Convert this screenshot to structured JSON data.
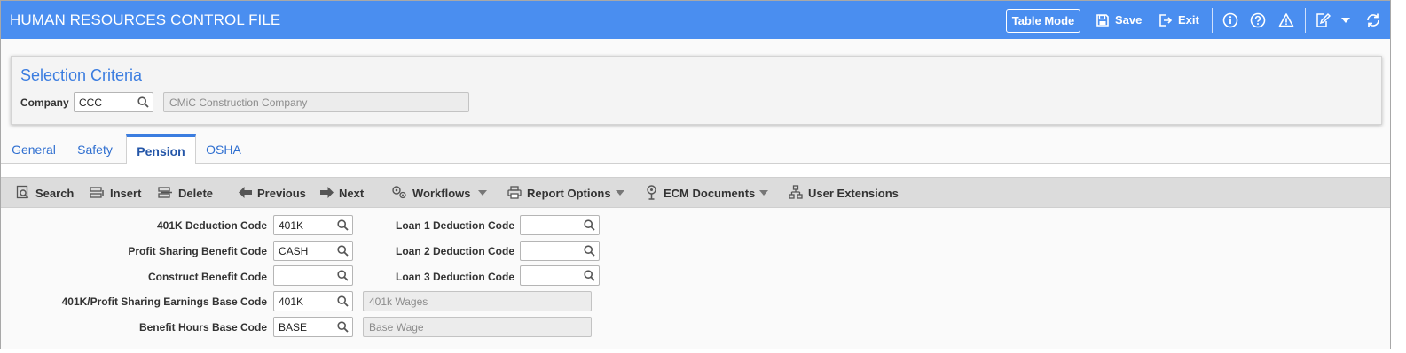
{
  "header": {
    "title": "HUMAN RESOURCES CONTROL FILE",
    "table_mode_label": "Table Mode",
    "save_label": "Save",
    "exit_label": "Exit",
    "icons": [
      "info-icon",
      "help-icon",
      "warning-icon",
      "edit-icon",
      "chevron-down-icon",
      "refresh-icon"
    ]
  },
  "criteria": {
    "title": "Selection Criteria",
    "company_label": "Company",
    "company_value": "CCC",
    "company_name": "CMiC Construction Company"
  },
  "tabs": [
    {
      "label": "General",
      "active": false
    },
    {
      "label": "Safety",
      "active": false
    },
    {
      "label": "Pension",
      "active": true
    },
    {
      "label": "OSHA",
      "active": false
    }
  ],
  "actions": {
    "search": "Search",
    "insert": "Insert",
    "delete": "Delete",
    "previous": "Previous",
    "next": "Next",
    "workflows": "Workflows",
    "report_options": "Report Options",
    "ecm_documents": "ECM Documents",
    "user_extensions": "User Extensions"
  },
  "form": {
    "left": [
      {
        "label": "401K Deduction Code",
        "value": "401K",
        "description": ""
      },
      {
        "label": "Profit Sharing Benefit Code",
        "value": "CASH",
        "description": ""
      },
      {
        "label": "Construct Benefit Code",
        "value": "",
        "description": ""
      },
      {
        "label": "401K/Profit Sharing Earnings Base Code",
        "value": "401K",
        "description": "401k Wages"
      },
      {
        "label": "Benefit Hours Base Code",
        "value": "BASE",
        "description": "Base Wage"
      }
    ],
    "right": [
      {
        "label": "Loan 1 Deduction Code",
        "value": ""
      },
      {
        "label": "Loan 2 Deduction Code",
        "value": ""
      },
      {
        "label": "Loan 3 Deduction Code",
        "value": ""
      }
    ]
  },
  "colors": {
    "header_bg": "#4a8ef0",
    "accent": "#3b7de0",
    "toolbar_bg": "#dcdcdc"
  }
}
